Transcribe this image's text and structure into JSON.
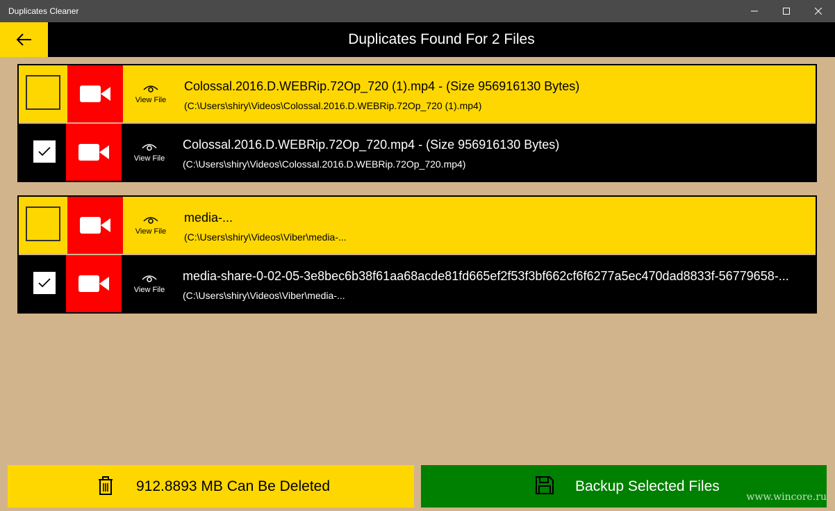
{
  "window": {
    "title": "Duplicates Cleaner"
  },
  "header": {
    "title": "Duplicates Found For 2 Files"
  },
  "groups": [
    {
      "rows": [
        {
          "checked": false,
          "view_label": "View File",
          "name": "Colossal.2016.D.WEBRip.72Op_720 (1).mp4 - (Size 956916130 Bytes)",
          "path": "(C:\\Users\\shiry\\Videos\\Colossal.2016.D.WEBRip.72Op_720 (1).mp4)"
        },
        {
          "checked": true,
          "view_label": "View File",
          "name": "Colossal.2016.D.WEBRip.72Op_720.mp4 - (Size 956916130 Bytes)",
          "path": "(C:\\Users\\shiry\\Videos\\Colossal.2016.D.WEBRip.72Op_720.mp4)"
        }
      ]
    },
    {
      "rows": [
        {
          "checked": false,
          "view_label": "View File",
          "name": "media-...",
          "path": "(C:\\Users\\shiry\\Videos\\Viber\\media-..."
        },
        {
          "checked": true,
          "view_label": "View File",
          "name": "media-share-0-02-05-3e8bec6b38f61aa68acde81fd665ef2f53f3bf662cf6f6277a5ec470dad8833f-56779658-...",
          "path": "(C:\\Users\\shiry\\Videos\\Viber\\media-..."
        }
      ]
    }
  ],
  "footer": {
    "delete_label": "912.8893 MB Can Be Deleted",
    "backup_label": "Backup Selected Files"
  },
  "watermark": "www.wincore.ru",
  "icons": {
    "back": "arrow-left-icon",
    "video": "video-camera-icon",
    "view": "eye-icon",
    "delete": "trash-icon",
    "backup": "save-icon"
  },
  "colors": {
    "accent_yellow": "#ffd700",
    "video_red": "#ff0000",
    "backup_green": "#008000",
    "background_tan": "#d2b48c"
  }
}
